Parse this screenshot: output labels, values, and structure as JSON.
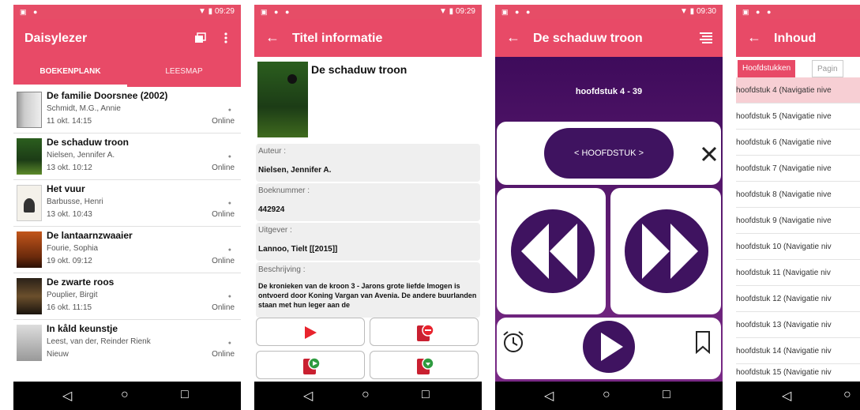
{
  "status": {
    "time1": "09:29",
    "time2": "09:29",
    "time3": "09:30"
  },
  "colors": {
    "accent": "#e84a67",
    "purple": "#3f1360",
    "red": "#e8232d"
  },
  "screen1": {
    "title": "Daisylezer",
    "tabs": [
      "BOEKENPLANK",
      "LEESMAP"
    ],
    "books": [
      {
        "title": "De familie Doorsnee (2002)",
        "author": "Schmidt, M.G., Annie",
        "date": "11 okt. 14:15",
        "status": "Online"
      },
      {
        "title": "De schaduw troon",
        "author": "Nielsen, Jennifer A.",
        "date": "13 okt. 10:12",
        "status": "Online"
      },
      {
        "title": "Het vuur",
        "author": "Barbusse, Henri",
        "date": "13 okt. 10:43",
        "status": "Online"
      },
      {
        "title": "De lantaarnzwaaier",
        "author": "Fourie, Sophia",
        "date": "19 okt. 09:12",
        "status": "Online"
      },
      {
        "title": "De zwarte roos",
        "author": "Pouplier, Birgit",
        "date": "16 okt. 11:15",
        "status": "Online"
      },
      {
        "title": "In kåld keunstje",
        "author": "Leest, van der, Reinder Rienk",
        "date": "Nieuw",
        "status": "Online"
      }
    ]
  },
  "screen2": {
    "title": "Titel informatie",
    "book_title": "De schaduw troon",
    "author_label": "Auteur :",
    "author_value": "Nielsen, Jennifer A.",
    "number_label": "Boeknummer :",
    "number_value": "442924",
    "publisher_label": "Uitgever :",
    "publisher_value": "Lannoo, Tielt [[2015]]",
    "desc_label": "Beschrijving :",
    "desc_value": "De kronieken van de kroon 3 - Jarons grote liefde Imogen is ontvoerd door Koning Vargan van Avenia. De andere buurlanden staan met hun leger aan de"
  },
  "screen3": {
    "title": "De schaduw troon",
    "chapter": "hoofdstuk 4 - 39",
    "nav_label": "< HOOFDSTUK >"
  },
  "screen4": {
    "title": "Inhoud",
    "tabs": [
      "Hoofdstukken",
      "Pagin"
    ],
    "items": [
      "hoofdstuk 4 (Navigatie nive",
      "hoofdstuk 5 (Navigatie nive",
      "hoofdstuk 6 (Navigatie nive",
      "hoofdstuk 7 (Navigatie nive",
      "hoofdstuk 8 (Navigatie nive",
      "hoofdstuk 9 (Navigatie nive",
      "hoofdstuk 10 (Navigatie niv",
      "hoofdstuk 11 (Navigatie niv",
      "hoofdstuk 12 (Navigatie niv",
      "hoofdstuk 13 (Navigatie niv",
      "hoofdstuk 14 (Navigatie niv",
      "hoofdstuk 15 (Navigatie niv"
    ]
  }
}
